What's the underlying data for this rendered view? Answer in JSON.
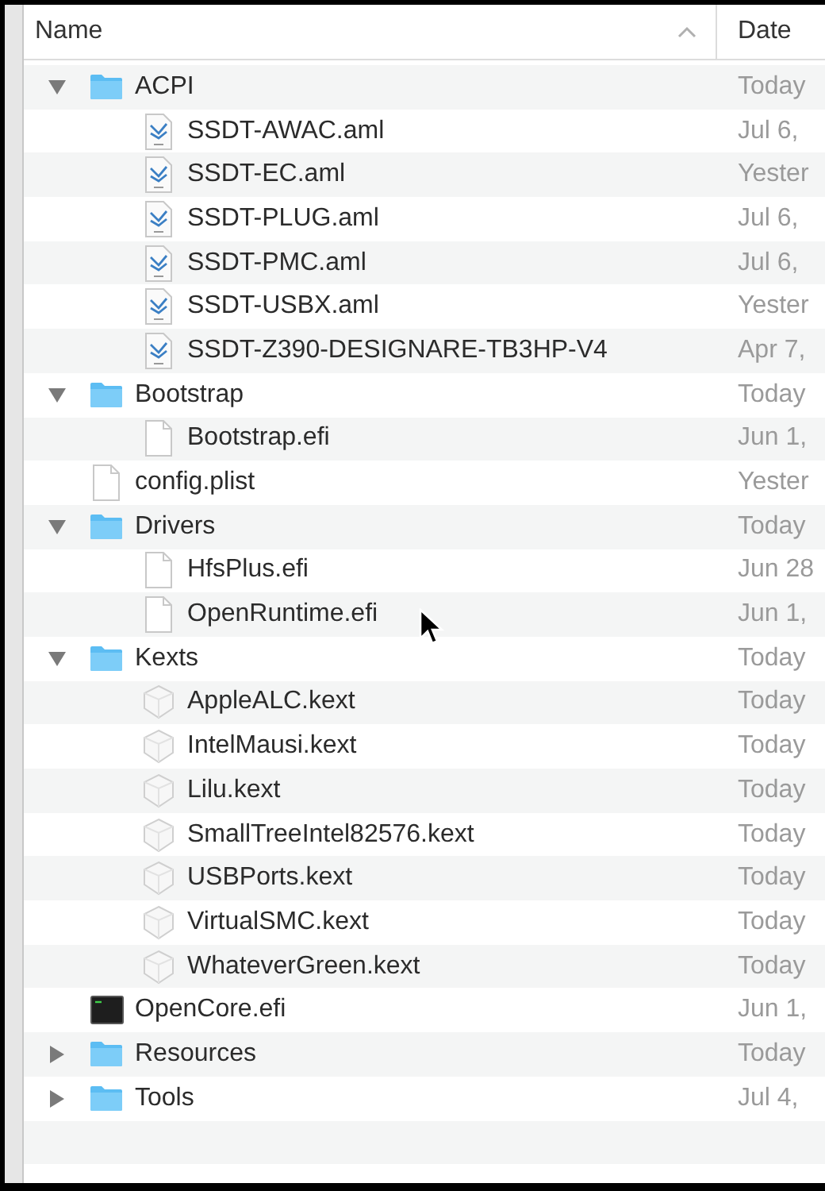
{
  "columns": [
    {
      "label": "Name",
      "sorted": true
    },
    {
      "label": "Date"
    }
  ],
  "items": [
    {
      "name": "ACPI",
      "date": "Today",
      "kind": "folder",
      "expanded": true,
      "children": [
        {
          "name": "SSDT-AWAC.aml",
          "date": "Jul 6,",
          "kind": "aml"
        },
        {
          "name": "SSDT-EC.aml",
          "date": "Yester",
          "kind": "aml"
        },
        {
          "name": "SSDT-PLUG.aml",
          "date": "Jul 6,",
          "kind": "aml"
        },
        {
          "name": "SSDT-PMC.aml",
          "date": "Jul 6,",
          "kind": "aml"
        },
        {
          "name": "SSDT-USBX.aml",
          "date": "Yester",
          "kind": "aml"
        },
        {
          "name": "SSDT-Z390-DESIGNARE-TB3HP-V4",
          "date": "Apr 7,",
          "kind": "aml"
        }
      ]
    },
    {
      "name": "Bootstrap",
      "date": "Today",
      "kind": "folder",
      "expanded": true,
      "children": [
        {
          "name": "Bootstrap.efi",
          "date": "Jun 1,",
          "kind": "file"
        }
      ]
    },
    {
      "name": "config.plist",
      "date": "Yester",
      "kind": "file"
    },
    {
      "name": "Drivers",
      "date": "Today",
      "kind": "folder",
      "expanded": true,
      "children": [
        {
          "name": "HfsPlus.efi",
          "date": "Jun 28",
          "kind": "file"
        },
        {
          "name": "OpenRuntime.efi",
          "date": "Jun 1,",
          "kind": "file"
        }
      ]
    },
    {
      "name": "Kexts",
      "date": "Today",
      "kind": "folder",
      "expanded": true,
      "children": [
        {
          "name": "AppleALC.kext",
          "date": "Today",
          "kind": "kext"
        },
        {
          "name": "IntelMausi.kext",
          "date": "Today",
          "kind": "kext"
        },
        {
          "name": "Lilu.kext",
          "date": "Today",
          "kind": "kext"
        },
        {
          "name": "SmallTreeIntel82576.kext",
          "date": "Today",
          "kind": "kext"
        },
        {
          "name": "USBPorts.kext",
          "date": "Today",
          "kind": "kext"
        },
        {
          "name": "VirtualSMC.kext",
          "date": "Today",
          "kind": "kext"
        },
        {
          "name": "WhateverGreen.kext",
          "date": "Today",
          "kind": "kext"
        }
      ]
    },
    {
      "name": "OpenCore.efi",
      "date": "Jun 1,",
      "kind": "exec"
    },
    {
      "name": "Resources",
      "date": "Today",
      "kind": "folder",
      "expanded": false
    },
    {
      "name": "Tools",
      "date": "Jul 4,",
      "kind": "folder",
      "expanded": false
    }
  ]
}
